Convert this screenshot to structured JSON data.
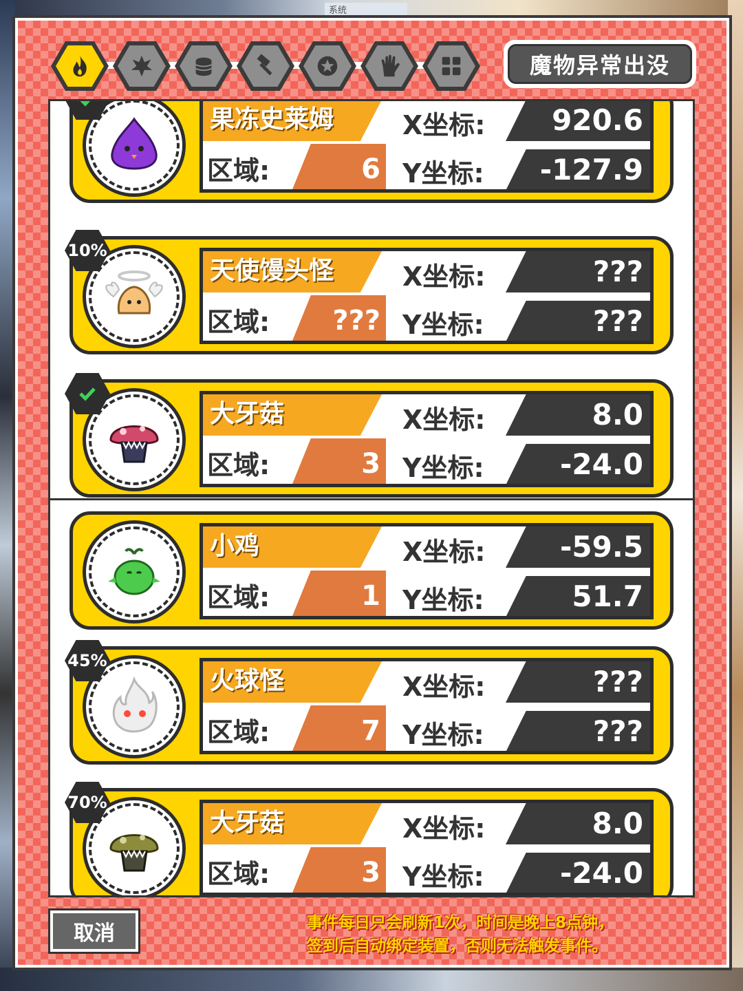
{
  "background": {
    "system_label": "系统"
  },
  "tabs": [
    {
      "icon": "flame-icon",
      "active": true
    },
    {
      "icon": "fire-burst-icon",
      "active": false
    },
    {
      "icon": "coins-icon",
      "active": false
    },
    {
      "icon": "hammer-icon",
      "active": false
    },
    {
      "icon": "star-medal-icon",
      "active": false
    },
    {
      "icon": "glove-icon",
      "active": false
    },
    {
      "icon": "grid-icon",
      "active": false
    }
  ],
  "event_button": {
    "label": "魔物异常出没"
  },
  "labels": {
    "area": "区域:",
    "x": "X坐标:",
    "y": "Y坐标:"
  },
  "monsters": [
    {
      "name": "果冻史莱姆",
      "area": "6",
      "x": "920.6",
      "y": "-127.9",
      "badge": "check",
      "color": "#8e3ad8"
    },
    {
      "name": "天使馒头怪",
      "area": "???",
      "x": "???",
      "y": "???",
      "badge": "10%",
      "color": "#f6c27a"
    },
    {
      "name": "大牙菇",
      "area": "3",
      "x": "8.0",
      "y": "-24.0",
      "badge": "check",
      "color": "#d24a6b"
    },
    {
      "name": "小鸡",
      "area": "1",
      "x": "-59.5",
      "y": "51.7",
      "badge": "",
      "color": "#4ccb4c"
    },
    {
      "name": "火球怪",
      "area": "7",
      "x": "???",
      "y": "???",
      "badge": "45%",
      "color": "#e6e6e6"
    },
    {
      "name": "大牙菇",
      "area": "3",
      "x": "8.0",
      "y": "-24.0",
      "badge": "70%",
      "color": "#8c8c3c"
    }
  ],
  "footer": {
    "cancel_label": "取消",
    "notice_line1": "事件每日只会刷新1次，时间是晚上8点钟，",
    "notice_line2": "签到后自动绑定装置，否则无法触发事件。"
  },
  "colors": {
    "accent": "#ffd400",
    "panel": "#f2665a",
    "name_bg": "#f6a821",
    "area_bg": "#e17a3e",
    "coord_bg": "#3a3a3a"
  }
}
